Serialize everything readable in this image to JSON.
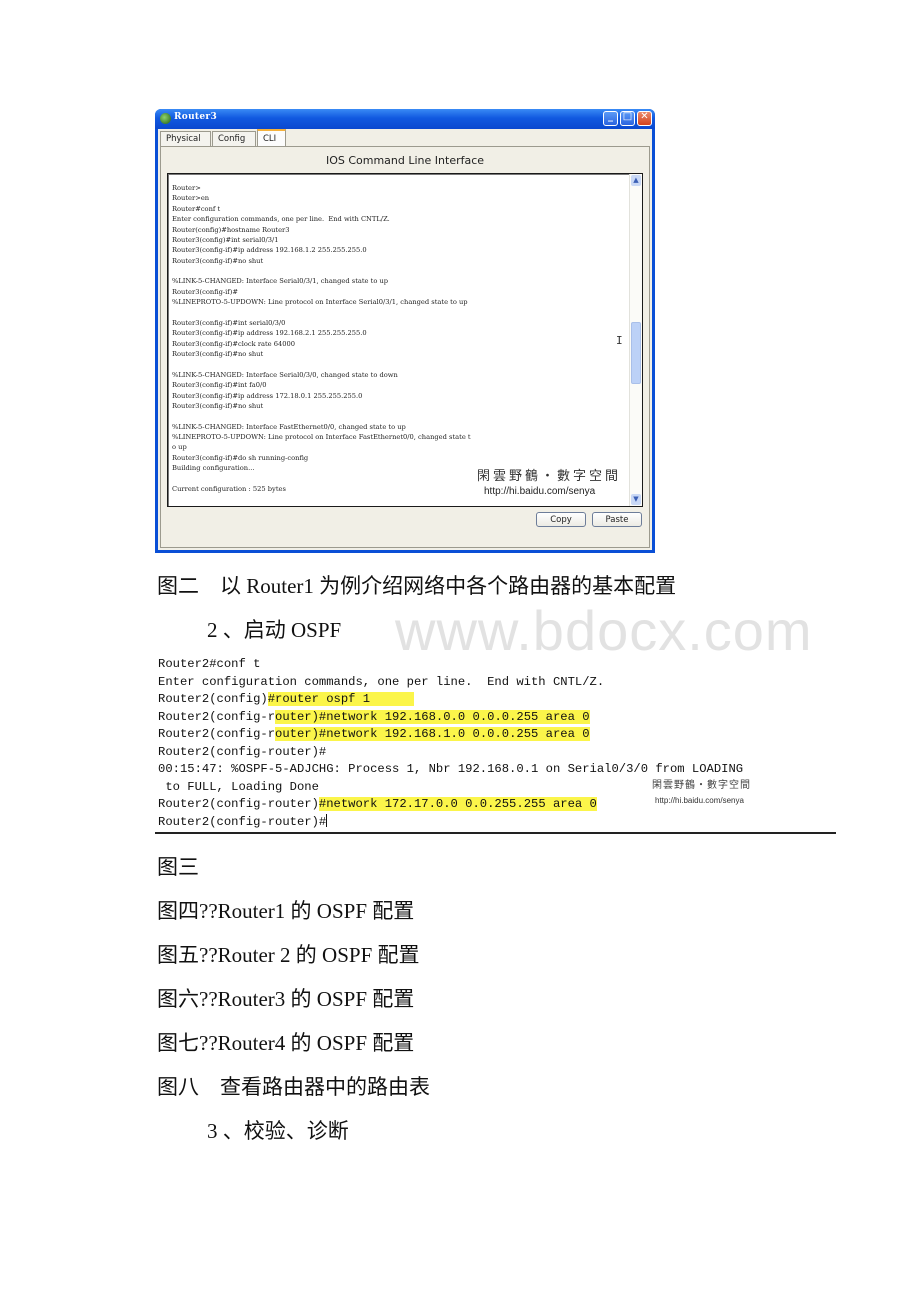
{
  "window": {
    "title": "Router3",
    "tabs": [
      {
        "label": "Physical",
        "active": false
      },
      {
        "label": "Config",
        "active": false
      },
      {
        "label": "CLI",
        "active": true
      }
    ],
    "cli_title": "IOS Command Line Interface",
    "terminal_lines": [
      "Router>",
      "Router>en",
      "Router#conf t",
      "Enter configuration commands, one per line.  End with CNTL/Z.",
      "Router(config)#hostname Router3",
      "Router3(config)#int serial0/3/1",
      "Router3(config-if)#ip address 192.168.1.2 255.255.255.0",
      "Router3(config-if)#no shut",
      "",
      "%LINK-5-CHANGED: Interface Serial0/3/1, changed state to up",
      "Router3(config-if)#",
      "%LINEPROTO-5-UPDOWN: Line protocol on Interface Serial0/3/1, changed state to up",
      "",
      "Router3(config-if)#int serial0/3/0",
      "Router3(config-if)#ip address 192.168.2.1 255.255.255.0",
      "Router3(config-if)#clock rate 64000",
      "Router3(config-if)#no shut",
      "",
      "%LINK-5-CHANGED: Interface Serial0/3/0, changed state to down",
      "Router3(config-if)#int fa0/0",
      "Router3(config-if)#ip address 172.18.0.1 255.255.255.0",
      "Router3(config-if)#no shut",
      "",
      "%LINK-5-CHANGED: Interface FastEthernet0/0, changed state to up",
      "%LINEPROTO-5-UPDOWN: Line protocol on Interface FastEthernet0/0, changed state t",
      "o up",
      "Router3(config-if)#do sh running-config",
      "Building configuration...",
      "",
      "Current configuration : 525 bytes"
    ],
    "watermark_cn": "閑雲野鶴・數字空間",
    "watermark_url": "http://hi.baidu.com/senya",
    "buttons": {
      "copy": "Copy",
      "paste": "Paste"
    },
    "scroll_position": 0.55
  },
  "doc": {
    "caption_fig2": "图二　以 Router1 为例介绍网络中各个路由器的基本配置",
    "section2": "2 、启动 OSPF",
    "site_watermark": "www.bdocx.com",
    "caption_fig3": "图三",
    "caption_fig4": "图四??Router1 的 OSPF 配置",
    "caption_fig5": "图五??Router 2 的 OSPF 配置",
    "caption_fig6": "图六??Router3 的 OSPF 配置",
    "caption_fig7": "图七??Router4 的 OSPF 配置",
    "caption_fig8": "图八　查看路由器中的路由表",
    "section3": "3 、校验、诊断"
  },
  "ospf_terminal": {
    "lines": [
      {
        "pre": "Router2#conf t",
        "hl": ""
      },
      {
        "pre": "Enter configuration commands, one per line.  End with CNTL/Z.",
        "hl": ""
      },
      {
        "pre": "Router2(config)",
        "hl": "#router ospf 1      "
      },
      {
        "pre": "Router2(config-r",
        "hl": "outer)#network 192.168.0.0 0.0.0.255 area 0"
      },
      {
        "pre": "Router2(config-r",
        "hl": "outer)#network 192.168.1.0 0.0.0.255 area 0"
      },
      {
        "pre": "Router2(config-router)#",
        "hl": ""
      },
      {
        "pre": "00:15:47: %OSPF-5-ADJCHG: Process 1, Nbr 192.168.0.1 on Serial0/3/0 from LOADING",
        "hl": ""
      },
      {
        "pre": " to FULL, Loading Done",
        "hl": ""
      },
      {
        "pre": "Router2(config-router)",
        "hl": "#network 172.17.0.0 0.0.255.255 area 0"
      },
      {
        "pre": "Router2(config-router)#",
        "hl": ""
      }
    ],
    "highlight_color": "#fbf54a",
    "watermark_cn": "閑雲野鶴・數字空間",
    "watermark_url": "http://hi.baidu.com/senya"
  }
}
